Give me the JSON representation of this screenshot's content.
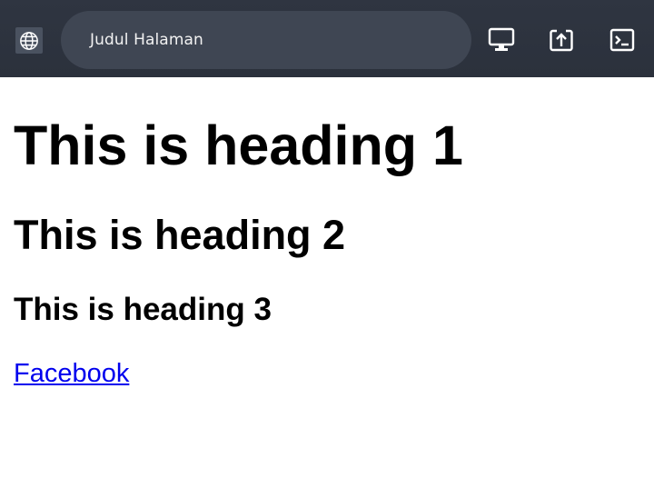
{
  "toolbar": {
    "page_title": "Judul Halaman",
    "site_icon": "globe-icon",
    "actions": [
      {
        "icon": "monitor-icon"
      },
      {
        "icon": "open-in-icon"
      },
      {
        "icon": "terminal-icon"
      }
    ]
  },
  "page": {
    "heading1": "This is heading 1",
    "heading2": "This is heading 2",
    "heading3": "This is heading 3",
    "link_text": "Facebook"
  },
  "colors": {
    "toolbar_bg": "#2e3440",
    "address_bg": "#3f4653",
    "link": "#0000ee"
  }
}
